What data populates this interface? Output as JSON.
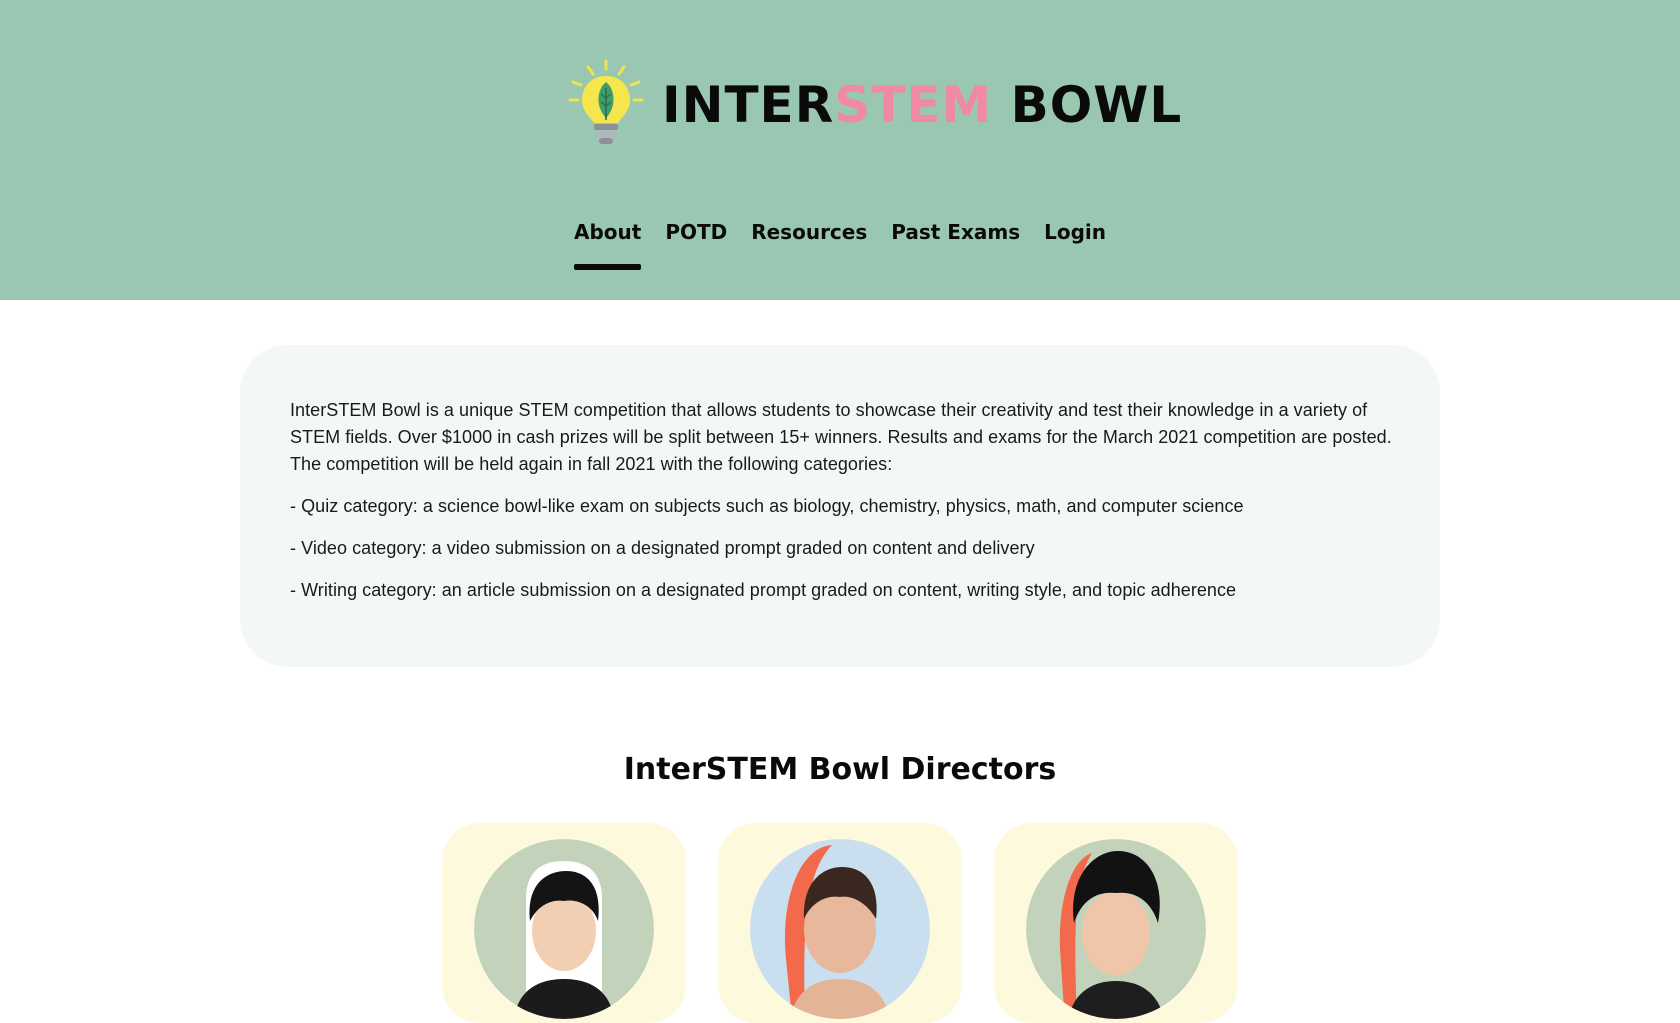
{
  "brand": {
    "part1": "INTER",
    "part2": "STEM",
    "part3": " BOWL",
    "logo_icon": "lightbulb-leaf-icon"
  },
  "nav": {
    "items": [
      {
        "label": "About",
        "active": true
      },
      {
        "label": "POTD",
        "active": false
      },
      {
        "label": "Resources",
        "active": false
      },
      {
        "label": "Past Exams",
        "active": false
      },
      {
        "label": "Login",
        "active": false
      }
    ]
  },
  "about": {
    "paragraphs": [
      "InterSTEM Bowl is a unique STEM competition that allows students to showcase their creativity and test their knowledge in a variety of STEM fields. Over $1000 in cash prizes will be split between 15+ winners. Results and exams for the March 2021 competition are posted. The competition will be held again in fall 2021 with the following categories:",
      "- Quiz category: a science bowl-like exam on subjects such as biology, chemistry, physics, math, and computer science",
      "- Video category: a video submission on a designated prompt graded on content and delivery",
      "- Writing category: an article submission on a designated prompt graded on content, writing style, and topic adherence"
    ]
  },
  "directors": {
    "title": "InterSTEM Bowl Directors"
  },
  "colors": {
    "header_bg": "#9ac7b1",
    "accent_pink": "#f08aa1",
    "card_bg": "#f3f7f5",
    "director_card_bg": "#fdf9dc",
    "photo_bg_green": "#c3d3bb",
    "photo_bg_blue": "#c9dff0",
    "cutout_orange": "#f26a4b"
  }
}
